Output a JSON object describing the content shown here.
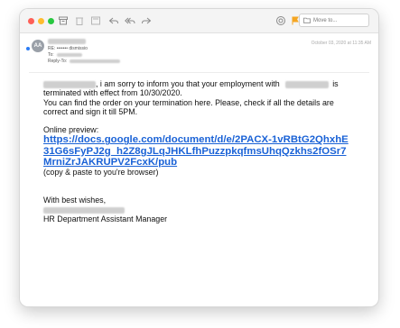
{
  "header": {
    "avatar_initials": "AA",
    "subject": "RE: ••••••• dismissio",
    "to_label": "To:",
    "reply_to_label": "Reply-To:",
    "date": "October 03, 2020 at 11:35 AM"
  },
  "toolbar": {
    "move_to_label": "Move to..."
  },
  "body": {
    "line1_suffix": ", i am sorry to inform you that your employment with",
    "line1_is": "is",
    "line2": "terminated with effect from 10/30/2020.",
    "line3": "You can find the order on your termination here. Please, check if all the details are correct and sign it till 5PM.",
    "preview_label": "Online preview:",
    "link": "https://docs.google.com/document/d/e/2PACX-1vRBtG2QhxhE31G6sFyPJ2g_h2Z8gJLqJHKLfhPuzzpkqfmsUhqQzkhs2fOSr7MrniZrJAKRUPV2FcxK/pub",
    "copy_note": "(copy & paste to you're browser)",
    "closing": "With best wishes,",
    "signature_title": "HR Department Assistant Manager"
  },
  "colors": {
    "close": "#fe5f57",
    "minimize": "#febc2e",
    "maximize": "#28c840",
    "link": "#1a62d6",
    "flag": "#f5a623"
  }
}
